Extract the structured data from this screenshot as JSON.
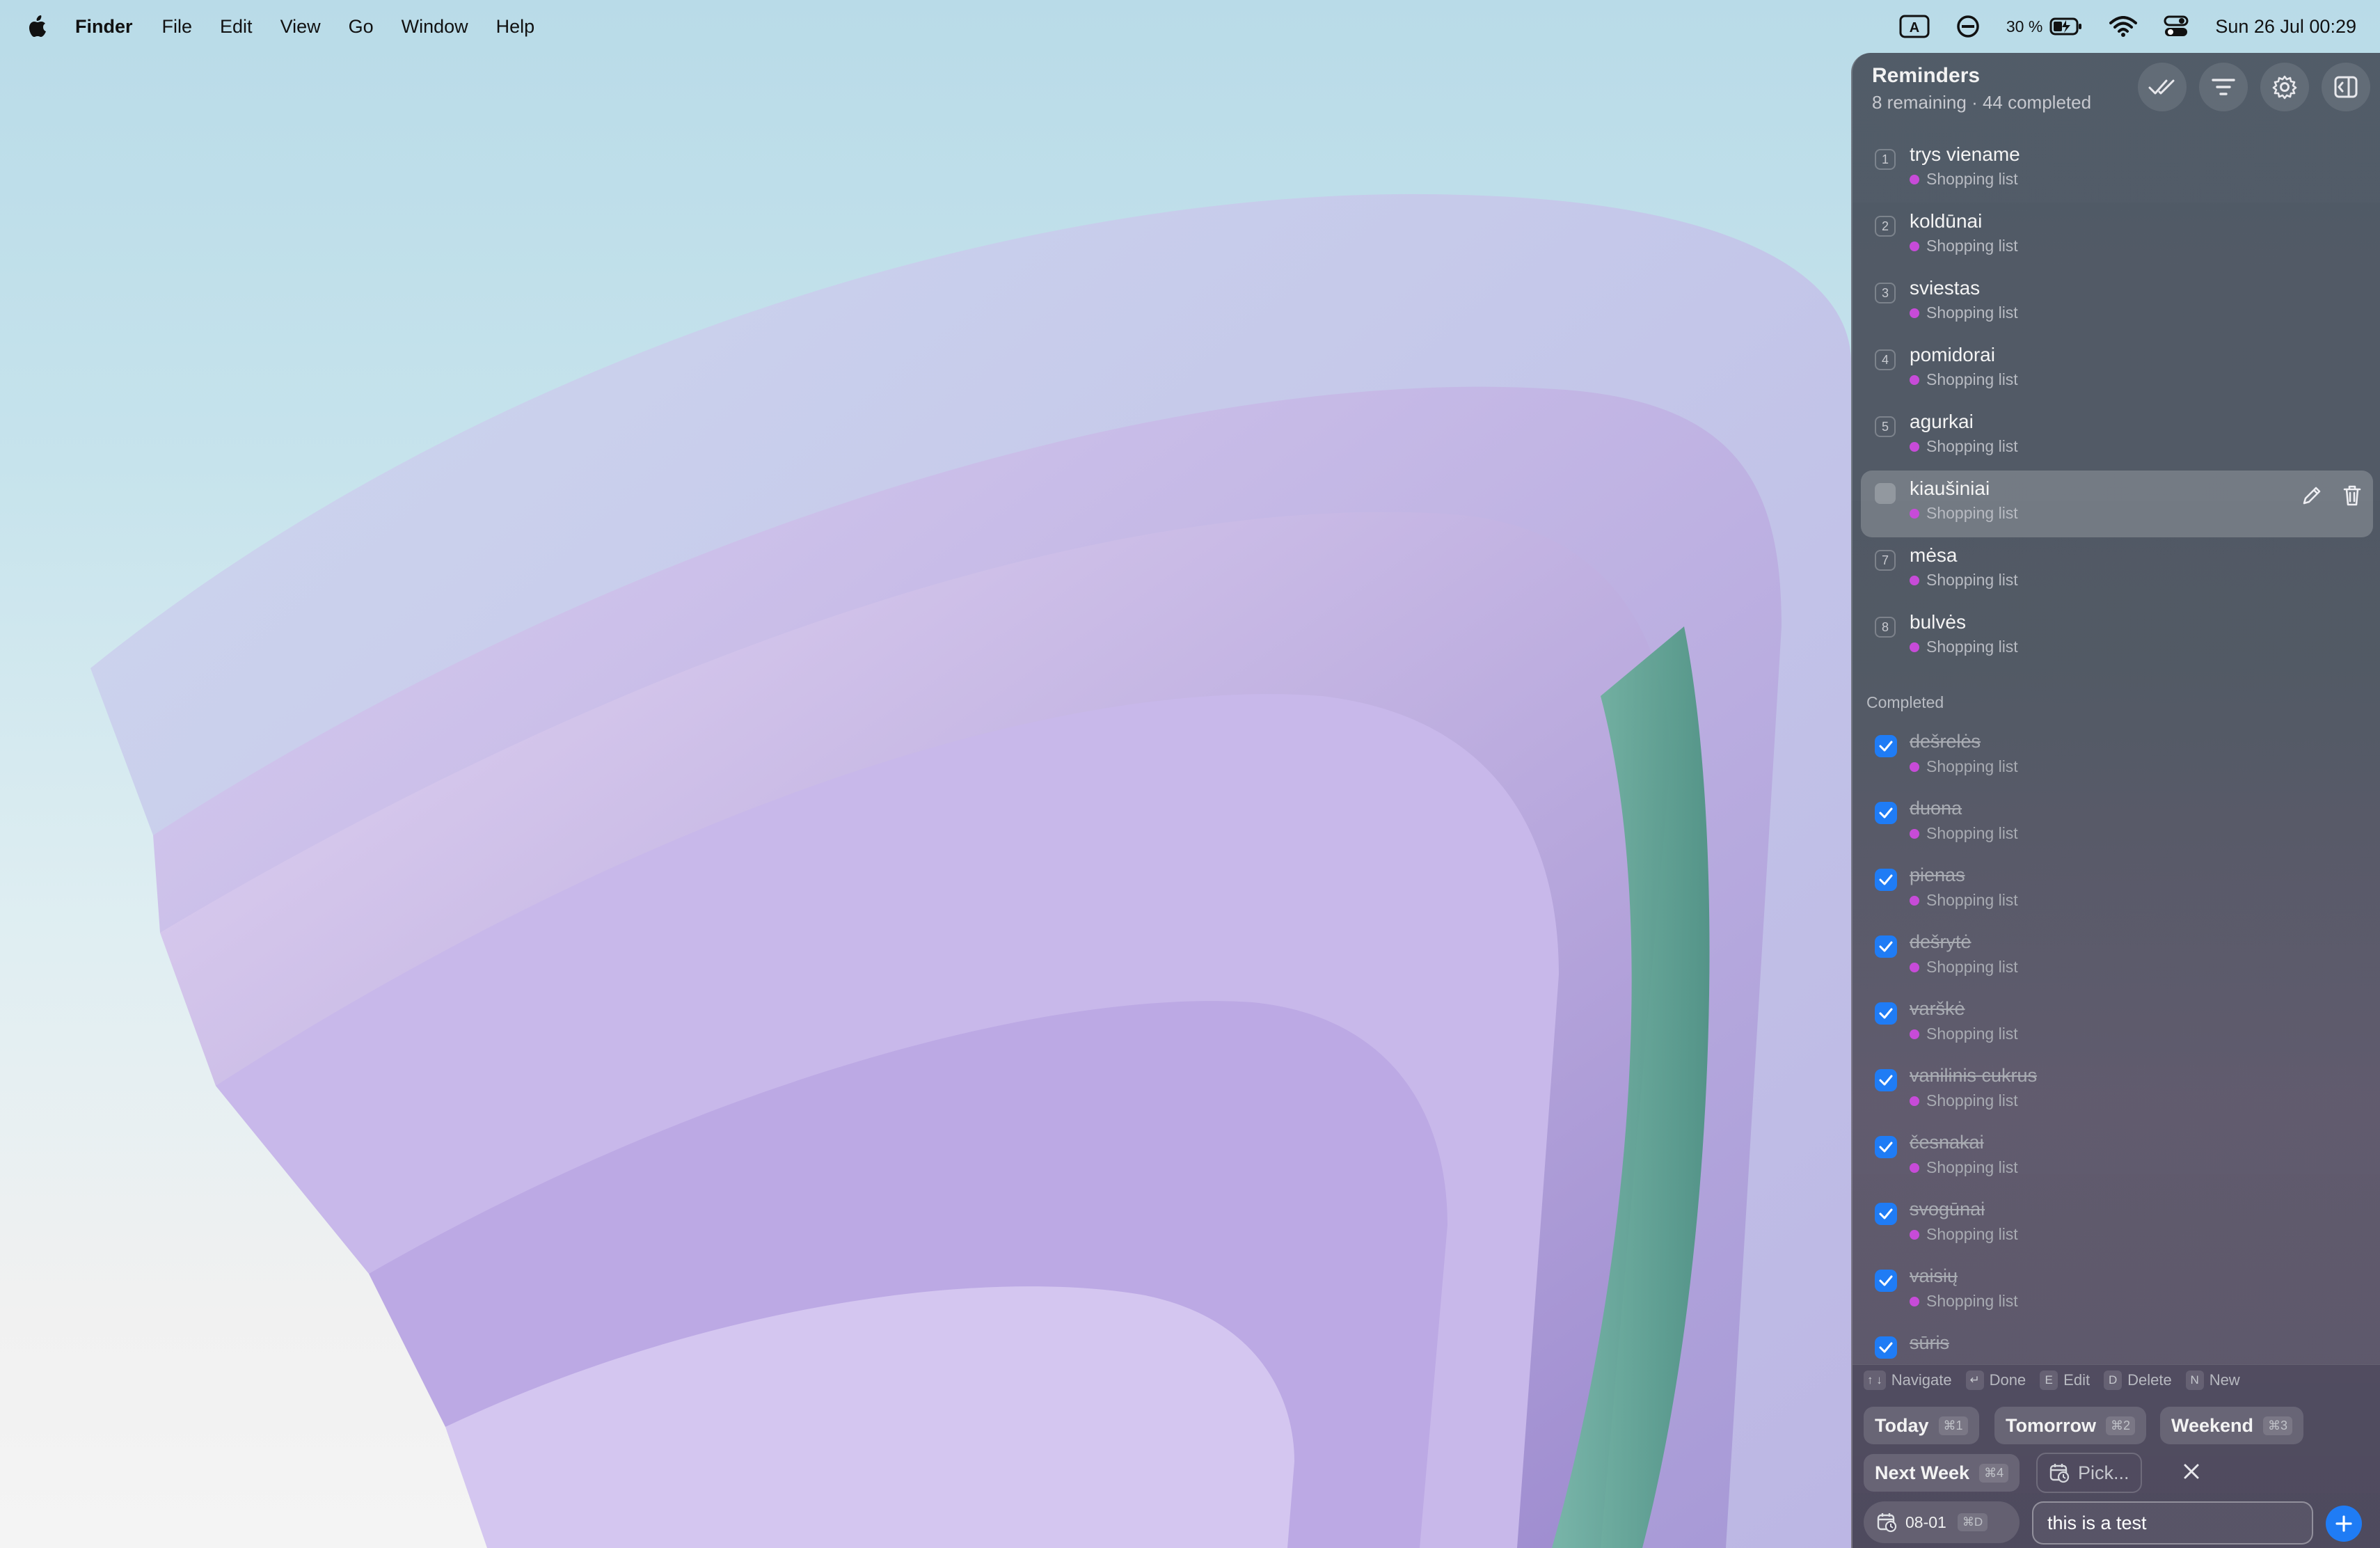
{
  "menubar": {
    "app_name": "Finder",
    "items": [
      "File",
      "Edit",
      "View",
      "Go",
      "Window",
      "Help"
    ],
    "battery": "30 %",
    "clock": "Sun 26 Jul  00:29",
    "keyboard_indicator": "A"
  },
  "reminders": {
    "title": "Reminders",
    "subtitle": "8 remaining · 44 completed",
    "open": [
      {
        "num": "1",
        "title": "trys viename",
        "list": "Shopping list"
      },
      {
        "num": "2",
        "title": "koldūnai",
        "list": "Shopping list"
      },
      {
        "num": "3",
        "title": "sviestas",
        "list": "Shopping list"
      },
      {
        "num": "4",
        "title": "pomidorai",
        "list": "Shopping list"
      },
      {
        "num": "5",
        "title": "agurkai",
        "list": "Shopping list"
      },
      {
        "num": "",
        "title": "kiaušiniai",
        "list": "Shopping list"
      },
      {
        "num": "7",
        "title": "mėsa",
        "list": "Shopping list"
      },
      {
        "num": "8",
        "title": "bulvės",
        "list": "Shopping list"
      }
    ],
    "completed_label": "Completed",
    "completed": [
      {
        "title": "dešrelės",
        "list": "Shopping list"
      },
      {
        "title": "duona",
        "list": "Shopping list"
      },
      {
        "title": "pienas",
        "list": "Shopping list"
      },
      {
        "title": "dešrytė",
        "list": "Shopping list"
      },
      {
        "title": "varškė",
        "list": "Shopping list"
      },
      {
        "title": "vanilinis cukrus",
        "list": "Shopping list"
      },
      {
        "title": "česnakai",
        "list": "Shopping list"
      },
      {
        "title": "svogūnai",
        "list": "Shopping list"
      },
      {
        "title": "vaisių",
        "list": "Shopping list"
      },
      {
        "title": "sūris",
        "list": ""
      }
    ],
    "hints": [
      {
        "keys": "↑ ↓",
        "label": "Navigate"
      },
      {
        "keys": "↵",
        "label": "Done"
      },
      {
        "keys": "E",
        "label": "Edit"
      },
      {
        "keys": "D",
        "label": "Delete"
      },
      {
        "keys": "N",
        "label": "New"
      }
    ],
    "quick_dates": {
      "today": "Today",
      "today_kbd": "⌘1",
      "tomorrow": "Tomorrow",
      "tomorrow_kbd": "⌘2",
      "weekend": "Weekend",
      "weekend_kbd": "⌘3",
      "next_week": "Next Week",
      "next_week_kbd": "⌘4",
      "pick": "Pick..."
    },
    "date_chip": {
      "value": "08-01",
      "kbd": "⌘D"
    },
    "input_value": "this is a test",
    "accent_color": "#1f7cf5",
    "list_color": "#c74bd8"
  }
}
